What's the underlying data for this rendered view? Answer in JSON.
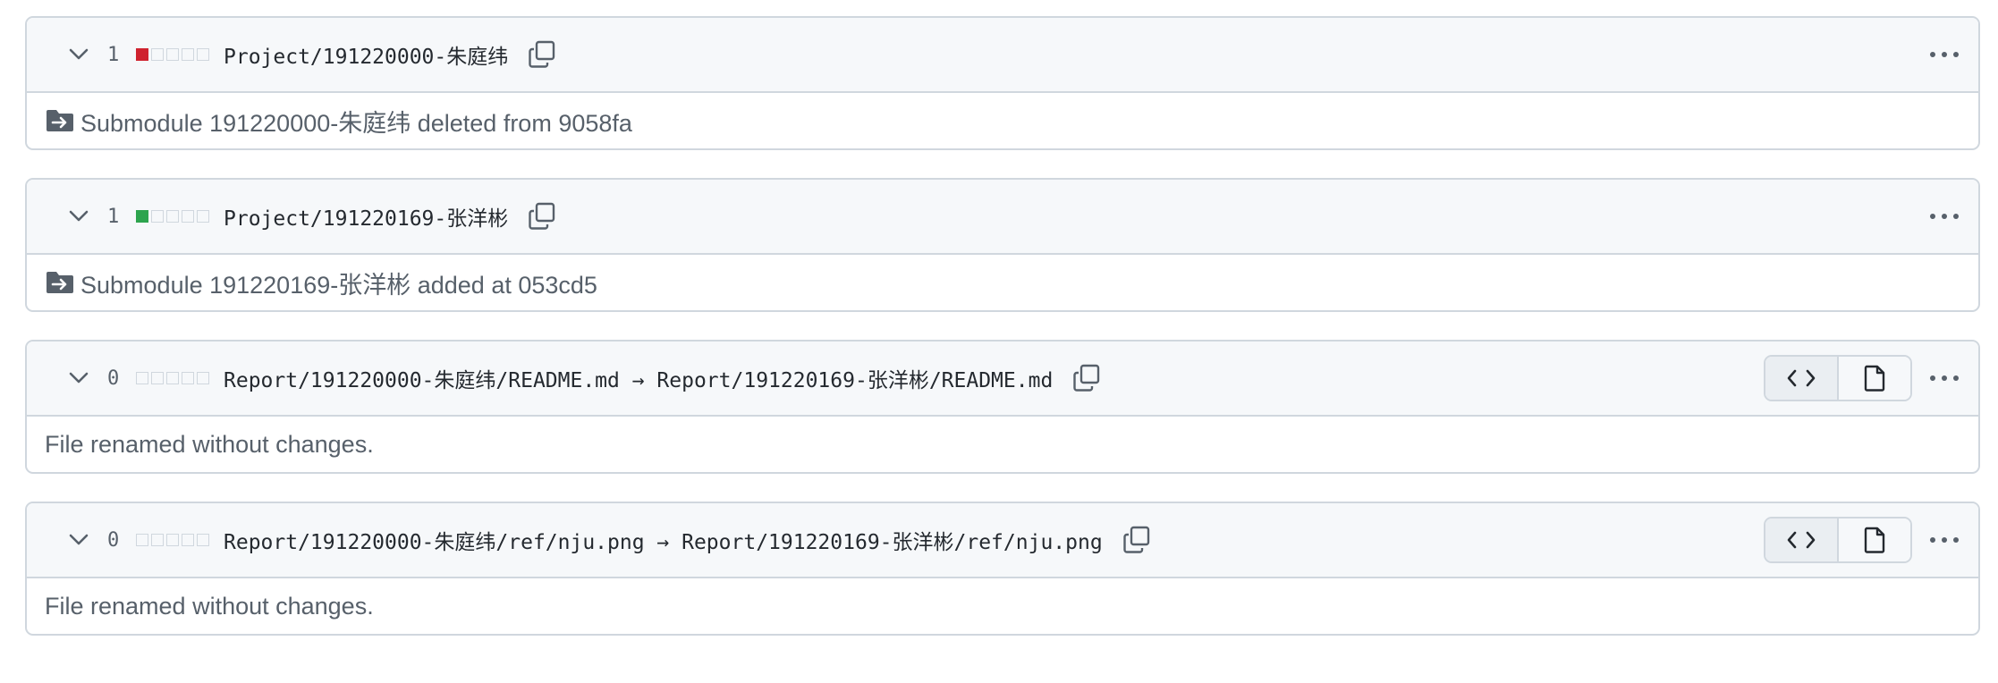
{
  "files": [
    {
      "count": "1",
      "diffstat": [
        "del",
        "neutral",
        "neutral",
        "neutral",
        "neutral"
      ],
      "path": "Project/191220000-朱庭纬",
      "has_view_buttons": false,
      "body_icon": "file-submodule-icon",
      "body_text": "Submodule 191220000-朱庭纬 deleted from 9058fa"
    },
    {
      "count": "1",
      "diffstat": [
        "add",
        "neutral",
        "neutral",
        "neutral",
        "neutral"
      ],
      "path": "Project/191220169-张洋彬",
      "has_view_buttons": false,
      "body_icon": "file-submodule-icon",
      "body_text": "Submodule 191220169-张洋彬 added at 053cd5"
    },
    {
      "count": "0",
      "diffstat": [
        "neutral",
        "neutral",
        "neutral",
        "neutral",
        "neutral"
      ],
      "path": "Report/191220000-朱庭纬/README.md → Report/191220169-张洋彬/README.md",
      "has_view_buttons": true,
      "body_icon": null,
      "body_text": "File renamed without changes."
    },
    {
      "count": "0",
      "diffstat": [
        "neutral",
        "neutral",
        "neutral",
        "neutral",
        "neutral"
      ],
      "path": "Report/191220000-朱庭纬/ref/nju.png → Report/191220169-张洋彬/ref/nju.png",
      "has_view_buttons": true,
      "body_icon": null,
      "body_text": "File renamed without changes."
    }
  ],
  "icons": {
    "collapse": "chevron-down-icon",
    "copy": "copy-icon",
    "code_view": "code-icon",
    "file_view": "file-icon",
    "more": "kebab-horizontal-icon"
  },
  "colors": {
    "deletion": "#cf222e",
    "addition": "#2da44e",
    "border": "#d0d7de",
    "header_bg": "#f6f8fa",
    "muted_text": "#57606a"
  }
}
